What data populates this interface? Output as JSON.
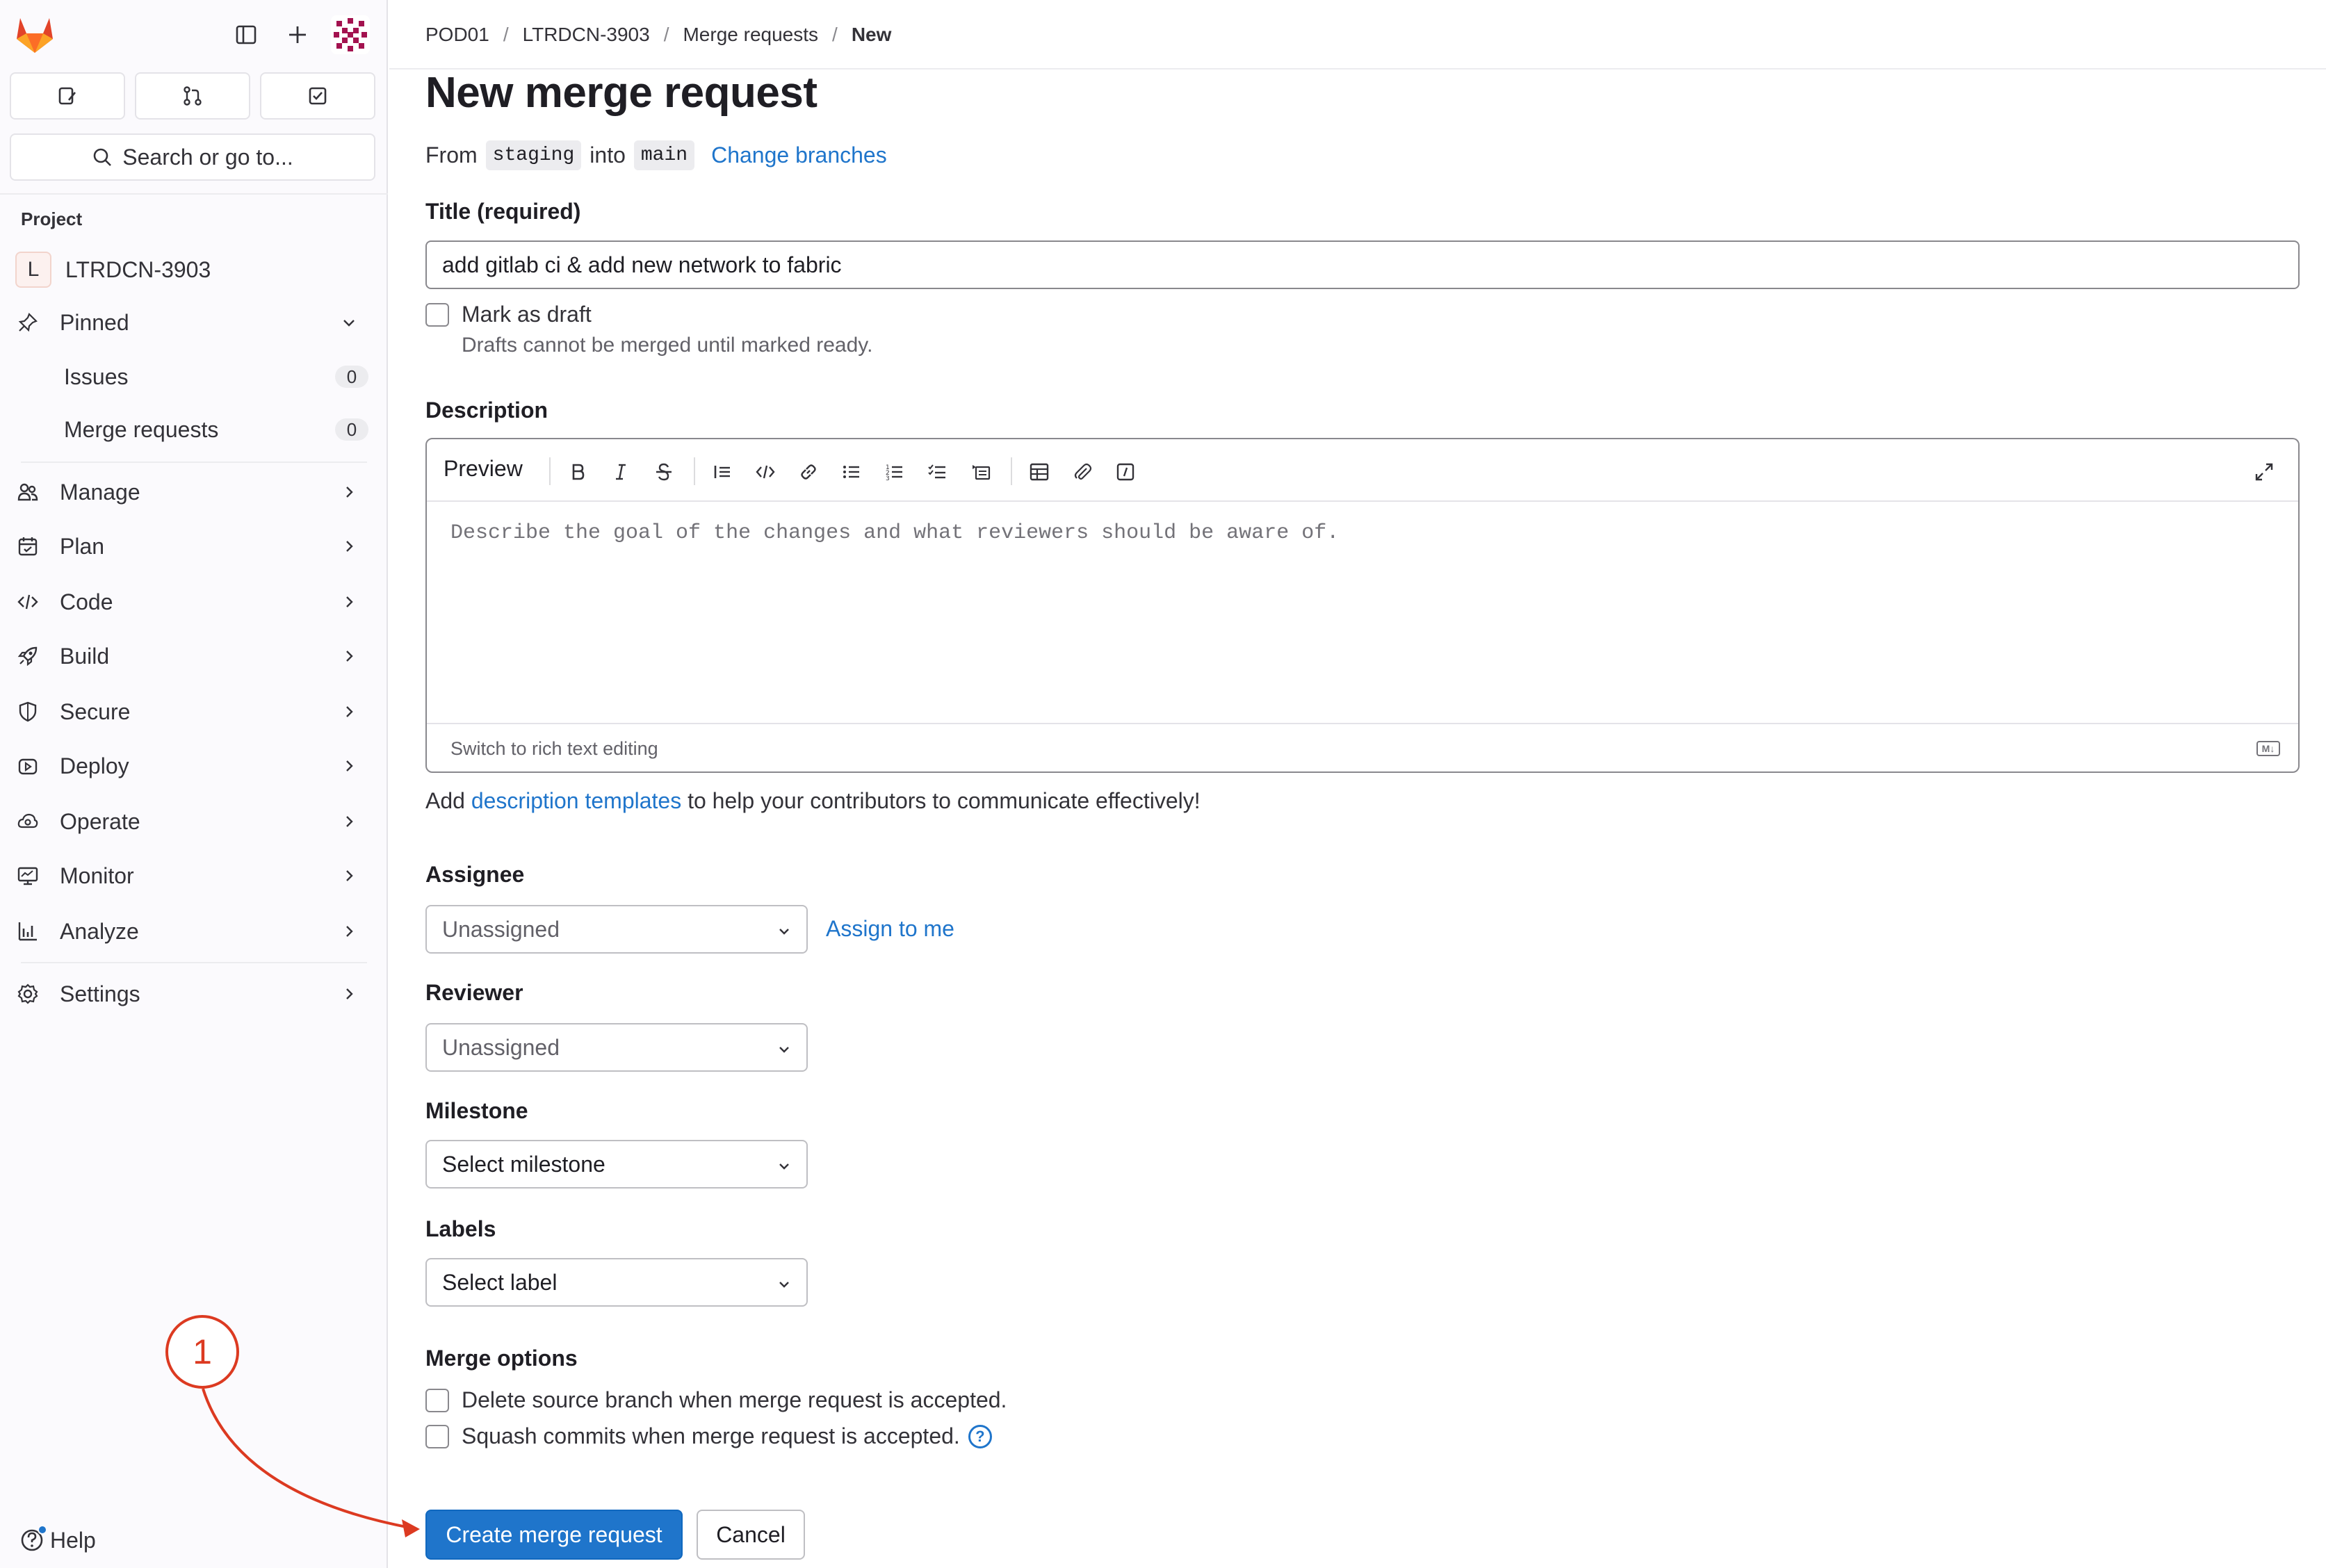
{
  "sidebar": {
    "search_label": "Search or go to...",
    "section_title": "Project",
    "project": {
      "initial": "L",
      "name": "LTRDCN-3903"
    },
    "pinned_label": "Pinned",
    "pinned_items": [
      {
        "label": "Issues",
        "count": "0"
      },
      {
        "label": "Merge requests",
        "count": "0"
      }
    ],
    "nav": [
      {
        "label": "Manage",
        "icon": "users-icon"
      },
      {
        "label": "Plan",
        "icon": "calendar-icon"
      },
      {
        "label": "Code",
        "icon": "code-icon"
      },
      {
        "label": "Build",
        "icon": "rocket-icon"
      },
      {
        "label": "Secure",
        "icon": "shield-icon"
      },
      {
        "label": "Deploy",
        "icon": "deploy-icon"
      },
      {
        "label": "Operate",
        "icon": "cloud-gear-icon"
      },
      {
        "label": "Monitor",
        "icon": "monitor-icon"
      },
      {
        "label": "Analyze",
        "icon": "chart-icon"
      },
      {
        "label": "Settings",
        "icon": "gear-icon"
      }
    ],
    "help_label": "Help"
  },
  "breadcrumb": [
    "POD01",
    "LTRDCN-3903",
    "Merge requests",
    "New"
  ],
  "page_title": "New merge request",
  "branches": {
    "from_label": "From",
    "source": "staging",
    "into_label": "into",
    "target": "main",
    "change_link": "Change branches"
  },
  "title_field": {
    "label": "Title (required)",
    "value": "add gitlab ci & add new network to fabric"
  },
  "draft": {
    "label": "Mark as draft",
    "help": "Drafts cannot be merged until marked ready."
  },
  "description": {
    "label": "Description",
    "preview_label": "Preview",
    "placeholder": "Describe the goal of the changes and what reviewers should be aware of.",
    "switch_label": "Switch to rich text editing",
    "md_badge": "M↓",
    "note_prefix": "Add",
    "note_link": "description templates",
    "note_suffix": "to help your contributors to communicate effectively!"
  },
  "assignee": {
    "label": "Assignee",
    "value": "Unassigned",
    "assign_me": "Assign to me"
  },
  "reviewer": {
    "label": "Reviewer",
    "value": "Unassigned"
  },
  "milestone": {
    "label": "Milestone",
    "value": "Select milestone"
  },
  "labels": {
    "label": "Labels",
    "value": "Select label"
  },
  "merge_options": {
    "label": "Merge options",
    "delete_branch": "Delete source branch when merge request is accepted.",
    "squash": "Squash commits when merge request is accepted.",
    "help_glyph": "?"
  },
  "buttons": {
    "create": "Create merge request",
    "cancel": "Cancel"
  },
  "annotation": {
    "step": "1"
  },
  "colors": {
    "accent": "#1f75cb",
    "annotation": "#dc3a21",
    "logo": "#e24329"
  }
}
